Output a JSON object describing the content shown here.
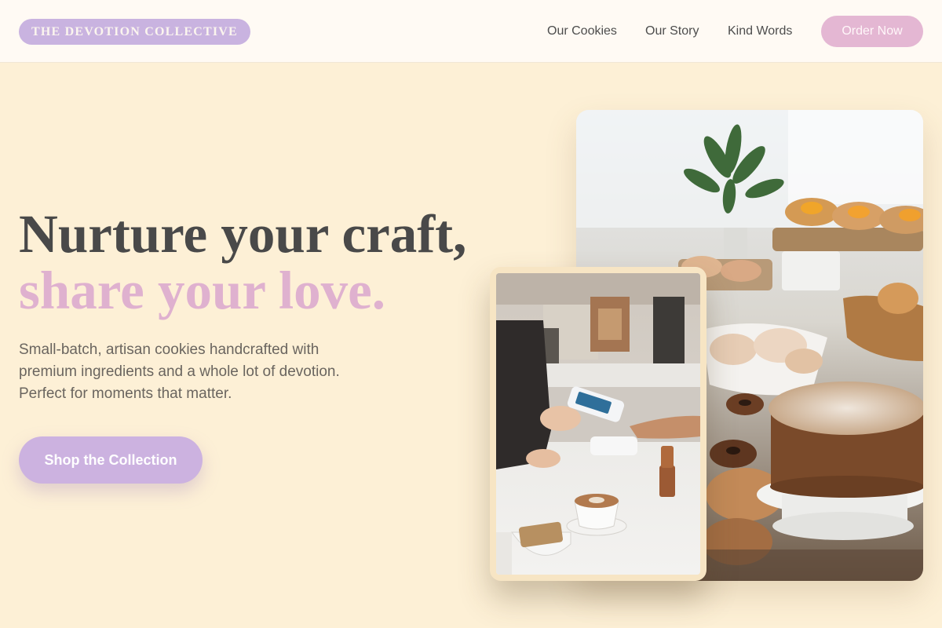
{
  "header": {
    "brand": "THE DEVOTION COLLECTIVE",
    "nav": [
      "Our Cookies",
      "Our Story",
      "Kind Words"
    ],
    "cta": "Order Now"
  },
  "hero": {
    "headline_line1": "Nurture your craft,",
    "headline_line2": "share your love.",
    "subtext_lines": [
      "Small-batch, artisan cookies handcrafted with",
      "premium ingredients and a whole lot of devotion.",
      "Perfect for moments that matter."
    ],
    "button": "Shop the Collection"
  },
  "images": {
    "large": "bakery-pastry-display-photo",
    "small": "cafe-counter-card-payment-photo"
  },
  "colors": {
    "background": "#fdf0d6",
    "header_bg": "#fffaf4",
    "brand_pill": "#c9b3e0",
    "accent_pink": "#e4b7d3",
    "accent_lavender": "#ccb2e0",
    "headline_dark": "#494949",
    "headline_pink": "#dfb1cf"
  }
}
